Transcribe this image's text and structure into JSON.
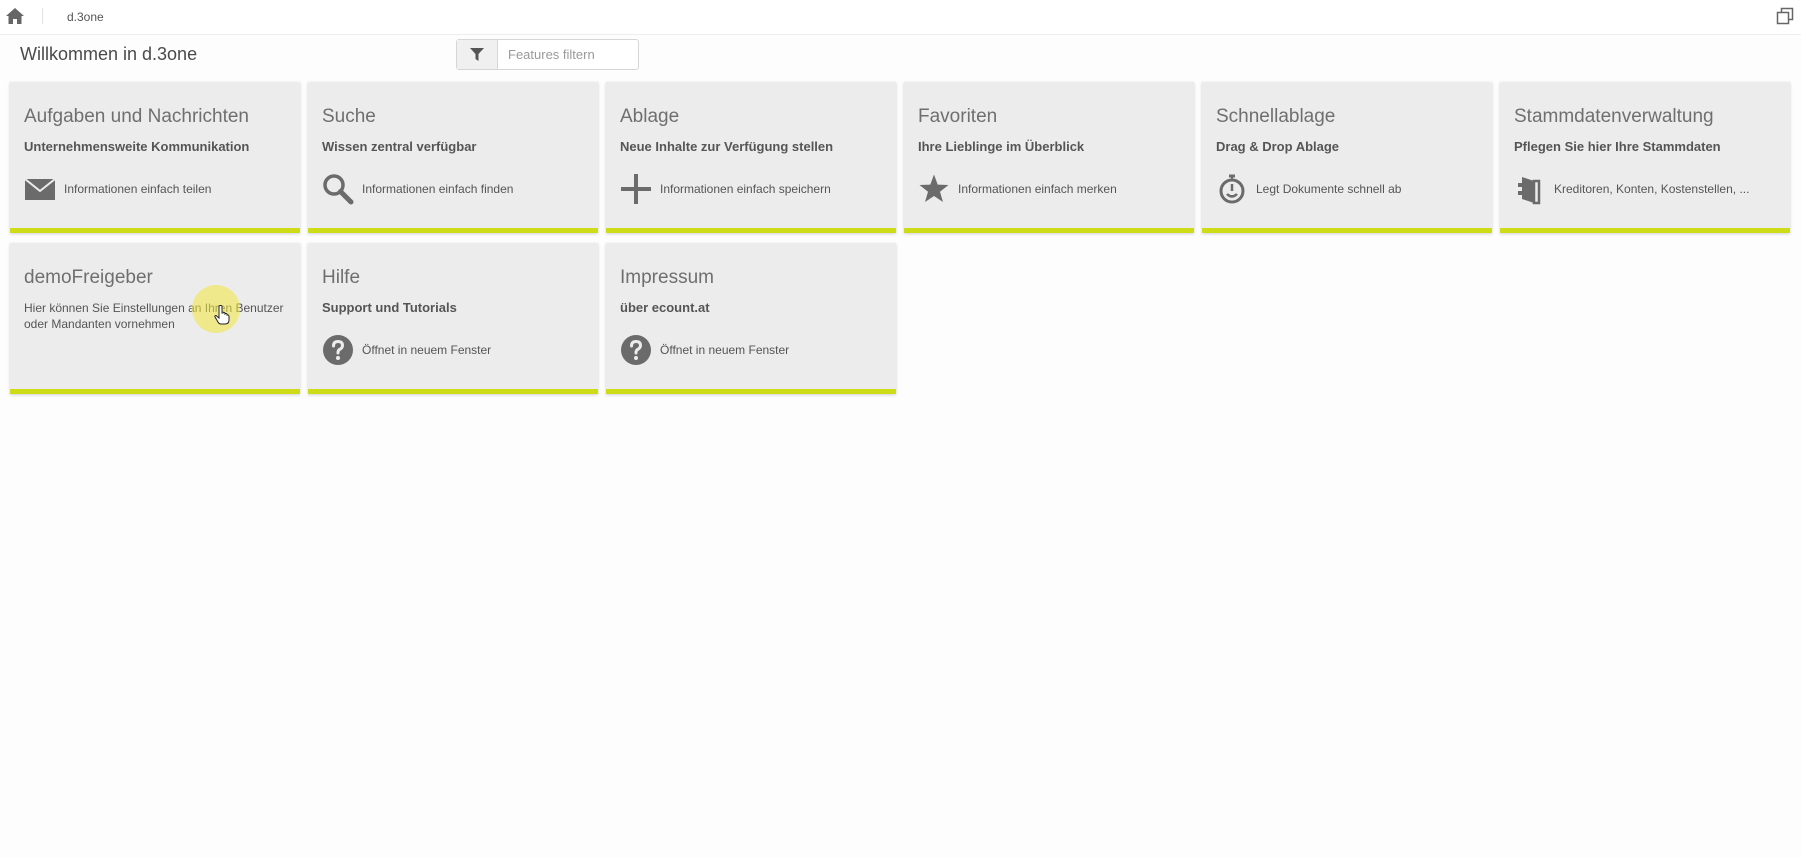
{
  "topbar": {
    "home_icon": "home-icon",
    "breadcrumb": "d.3one",
    "window_icon": "restore-window-icon"
  },
  "header": {
    "title": "Willkommen in d.3one",
    "filter": {
      "icon": "filter-icon",
      "placeholder": "Features filtern"
    }
  },
  "tiles": [
    {
      "title": "Aufgaben und Nachrichten",
      "subtitle": "Unternehmensweite Kommunikation",
      "icon": "envelope-icon",
      "text": "Informationen einfach teilen"
    },
    {
      "title": "Suche",
      "subtitle": "Wissen zentral verfügbar",
      "icon": "search-icon",
      "text": "Informationen einfach finden"
    },
    {
      "title": "Ablage",
      "subtitle": "Neue Inhalte zur Verfügung stellen",
      "icon": "plus-icon",
      "text": "Informationen einfach speichern"
    },
    {
      "title": "Favoriten",
      "subtitle": "Ihre Lieblinge im Überblick",
      "icon": "star-icon",
      "text": "Informationen einfach merken"
    },
    {
      "title": "Schnellablage",
      "subtitle": "Drag & Drop Ablage",
      "icon": "stopwatch-icon",
      "text": "Legt Dokumente schnell ab"
    },
    {
      "title": "Stammdatenverwaltung",
      "subtitle": "Pflegen Sie hier Ihre Stammdaten",
      "icon": "binder-icon",
      "text": "Kreditoren, Konten, Kostenstellen, ..."
    },
    {
      "title": "demoFreigeber",
      "subtitle": "Hier können Sie Einstellungen an Ihren Benutzer oder Mandanten vornehmen"
    },
    {
      "title": "Hilfe",
      "subtitle": "Support und Tutorials",
      "icon": "help-icon",
      "text": "Öffnet in neuem Fenster"
    },
    {
      "title": "Impressum",
      "subtitle": "über ecount.at",
      "icon": "help-icon",
      "text": "Öffnet in neuem Fenster"
    }
  ],
  "colors": {
    "accent": "#cddc17",
    "tile_bg": "#edecec",
    "icon": "#6b6b6b"
  }
}
